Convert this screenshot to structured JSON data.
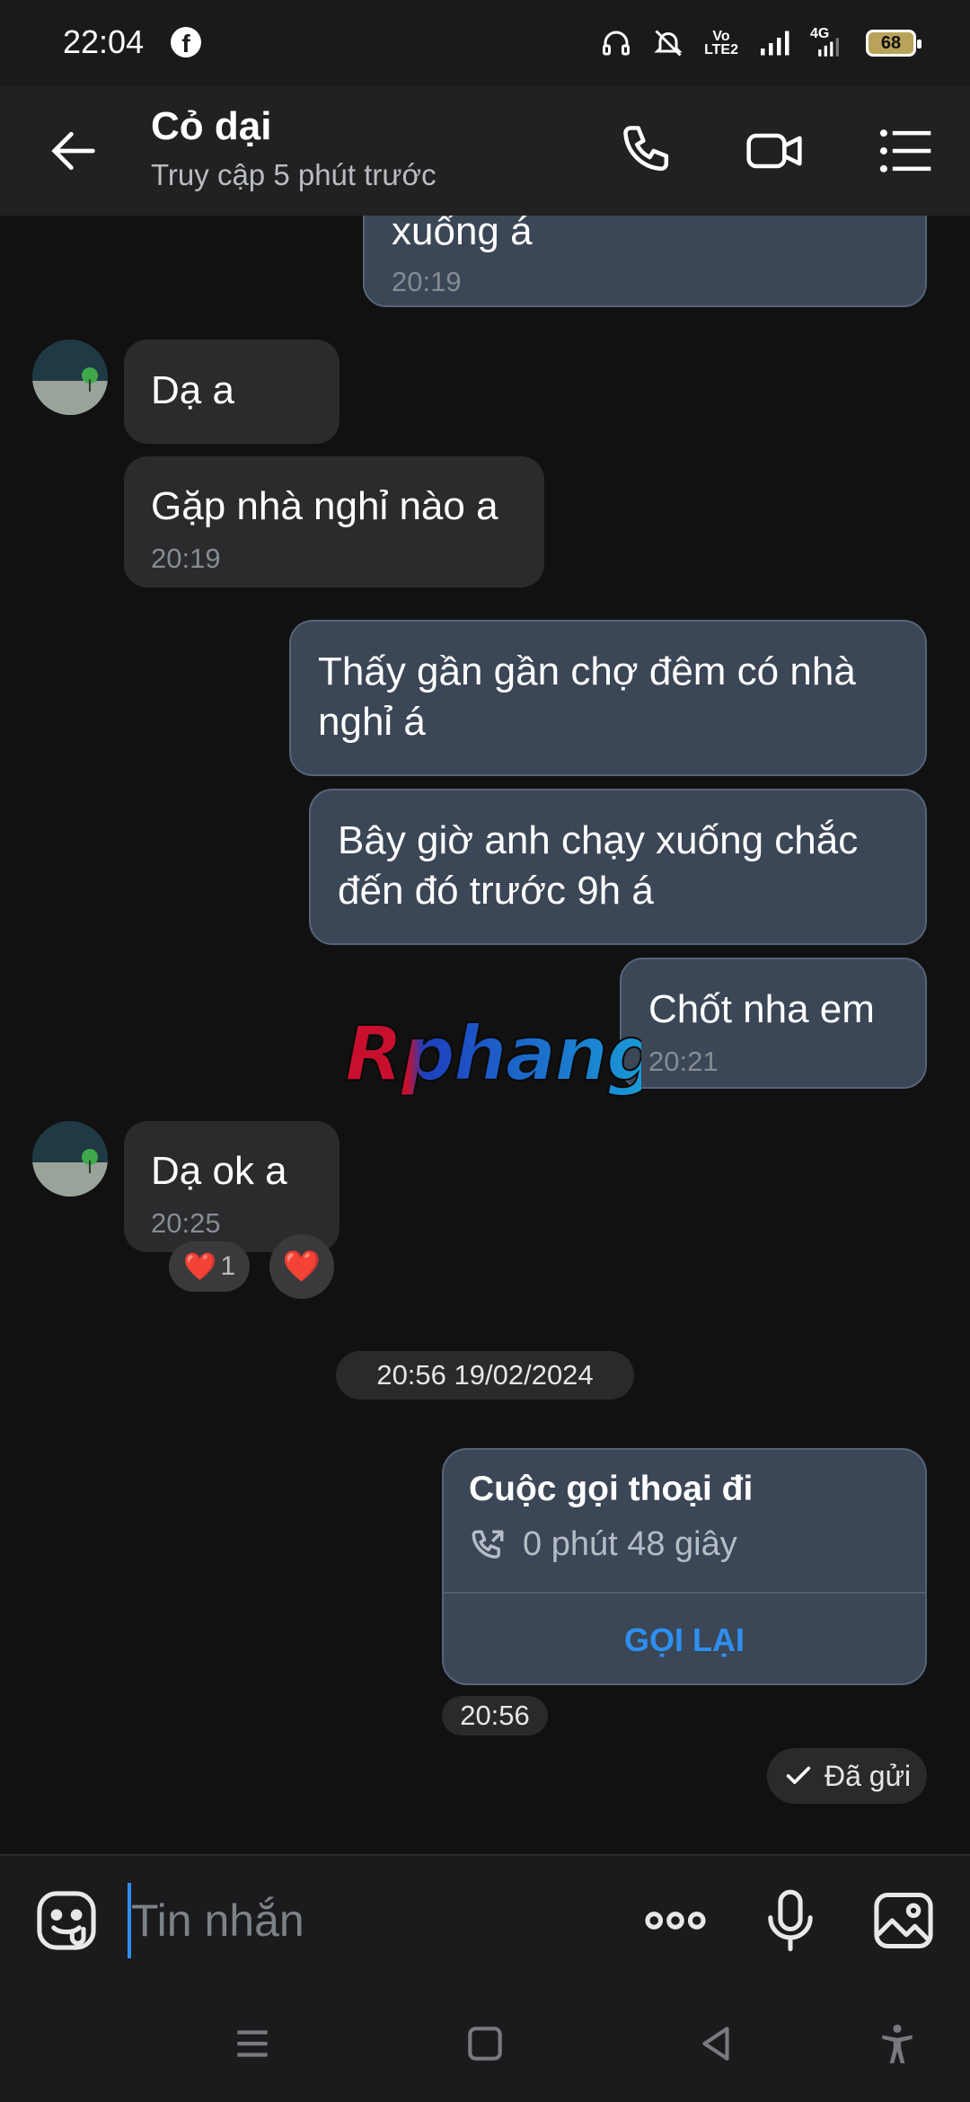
{
  "status_bar": {
    "time": "22:04",
    "app_icon": "facebook-icon",
    "net_label_top": "Vo",
    "net_label_bottom": "LTE2",
    "network": "4G",
    "battery": "68"
  },
  "header": {
    "title": "Cỏ dại",
    "subtitle": "Truy cập 5 phút trước",
    "icons": [
      "back-arrow-icon",
      "phone-icon",
      "video-camera-icon",
      "menu-list-icon"
    ]
  },
  "messages": [
    {
      "dir": "out",
      "text": "xuống á",
      "time": "20:19"
    },
    {
      "dir": "in",
      "text": "Dạ a",
      "time": ""
    },
    {
      "dir": "in",
      "text": "Gặp nhà nghỉ nào a",
      "time": "20:19"
    },
    {
      "dir": "out",
      "text": "Thấy gần gần chợ đêm có nhà nghỉ á",
      "time": ""
    },
    {
      "dir": "out",
      "text": "Bây giờ anh chạy xuống chắc đến đó trước 9h á",
      "time": ""
    },
    {
      "dir": "out",
      "text": "Chốt nha em",
      "time": "20:21"
    },
    {
      "dir": "in",
      "text": "Dạ ok a",
      "time": "20:25",
      "reaction": "❤️",
      "reaction_count": "1",
      "react_button": "❤️"
    }
  ],
  "date_separator": "20:56 19/02/2024",
  "call_card": {
    "title": "Cuộc gọi thoại đi",
    "duration": "0 phút 48 giây",
    "action": "GỌI LẠI",
    "time": "20:56"
  },
  "sent_status": "Đã gửi",
  "watermark": "Rphang",
  "input": {
    "placeholder": "Tin nhắn",
    "icons": [
      "emoji-icon",
      "more-dots-icon",
      "microphone-icon",
      "image-icon"
    ]
  },
  "colors": {
    "accent": "#2e8ff0",
    "outgoing_bubble": "#3b4656",
    "incoming_bubble": "#2b2b2d",
    "background": "#111111"
  }
}
